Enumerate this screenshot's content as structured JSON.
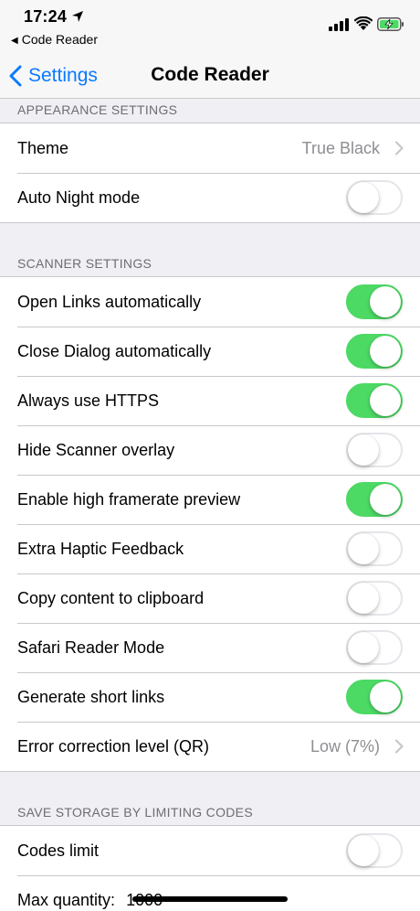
{
  "status_bar": {
    "time": "17:24",
    "back_app": "Code Reader"
  },
  "nav": {
    "back_label": "Settings",
    "title": "Code Reader"
  },
  "sections": {
    "appearance": {
      "header": "APPEARANCE SETTINGS",
      "theme_label": "Theme",
      "theme_value": "True Black",
      "auto_night_label": "Auto Night mode",
      "auto_night_on": false
    },
    "scanner": {
      "header": "SCANNER SETTINGS",
      "items": [
        {
          "label": "Open Links automatically",
          "on": true
        },
        {
          "label": "Close Dialog automatically",
          "on": true
        },
        {
          "label": "Always use HTTPS",
          "on": true
        },
        {
          "label": "Hide Scanner overlay",
          "on": false
        },
        {
          "label": "Enable high framerate preview",
          "on": true
        },
        {
          "label": "Extra Haptic Feedback",
          "on": false
        },
        {
          "label": "Copy content to clipboard",
          "on": false
        },
        {
          "label": "Safari Reader Mode",
          "on": false
        },
        {
          "label": "Generate short links",
          "on": true
        }
      ],
      "error_label": "Error correction level (QR)",
      "error_value": "Low (7%)"
    },
    "storage": {
      "header": "SAVE STORAGE BY LIMITING CODES",
      "codes_limit_label": "Codes limit",
      "codes_limit_on": false,
      "max_quantity_label": "Max quantity:",
      "max_quantity_value": "1000"
    }
  },
  "colors": {
    "accent": "#0a7aff",
    "toggle_on": "#4cd964",
    "background": "#efeff4"
  }
}
